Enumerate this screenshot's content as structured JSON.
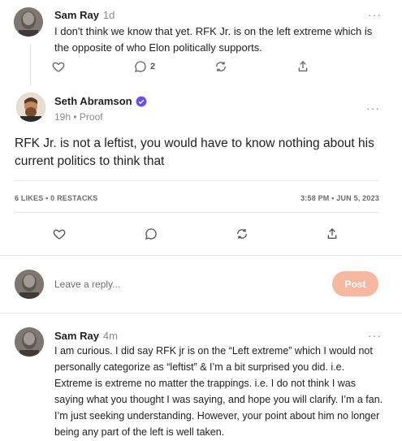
{
  "comment1": {
    "author": "Sam Ray",
    "time": "1d",
    "text": "I don't think we know that yet. RFK Jr. is on the left extreme which is the opposite of who Elon politically supports.",
    "reply_count": "2",
    "more": "···"
  },
  "main_post": {
    "author": "Seth Abramson",
    "meta": "19h • Proof",
    "text": "RFK Jr. is not a leftist, you would have to know nothing about his current politics to think that",
    "stats": "6 LIKES • 0 RESTACKS",
    "timestamp": "3:58 PM • JUN 5, 2023",
    "more": "···"
  },
  "reply_box": {
    "placeholder": "Leave a reply...",
    "post_label": "Post"
  },
  "comment2": {
    "author": "Sam Ray",
    "time": "4m",
    "text": "I am curious. I did say RFK jr is on the “Left extreme” which I would not personally categorize as “leftist” & I’m a bit surprised you did. i.e. Extreme is extreme no matter the trappings. i.e. I do not think I was saying what you thought I was saying, and hope you will clarify.  I’m a fan. I’m just seeking understanding. However, your point about him no longer being any part of the left is well taken.",
    "more": "···"
  },
  "colors": {
    "verified": "#6a4cf5",
    "post_button": "#f7b8a1",
    "muted": "#8a8a8a"
  }
}
